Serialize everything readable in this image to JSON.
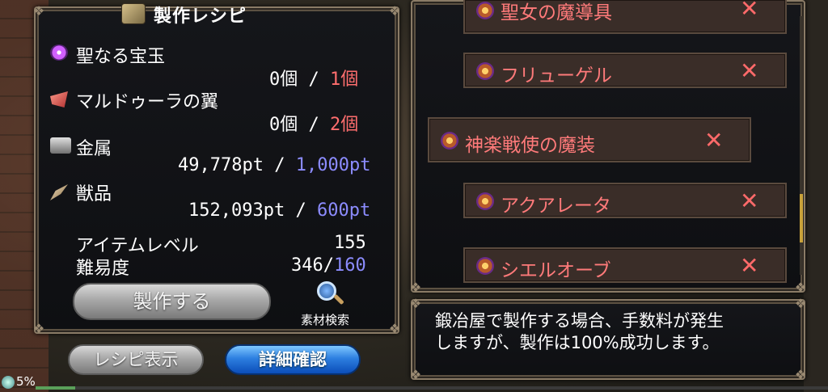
{
  "window": {
    "title": "製作レシピ"
  },
  "materials": [
    {
      "name": "聖なる宝玉",
      "icon": "jewel-icon",
      "have": "0個",
      "need": "1個",
      "need_color": "red"
    },
    {
      "name": "マルドゥーラの翼",
      "icon": "wing-icon",
      "have": "0個",
      "need": "2個",
      "need_color": "red"
    },
    {
      "name": "金属",
      "icon": "metal-ingot-icon",
      "have": "49,778pt",
      "need": "1,000pt",
      "need_color": "blue"
    },
    {
      "name": "獣品",
      "icon": "fang-icon",
      "have": "152,093pt",
      "need": "600pt",
      "need_color": "blue"
    }
  ],
  "separator": "/",
  "stats": {
    "item_level_label": "アイテムレベル",
    "item_level_value": "155",
    "difficulty_label": "難易度",
    "difficulty_current": "346/",
    "difficulty_max": "160"
  },
  "buttons": {
    "craft": "製作する",
    "material_search": "素材検索",
    "recipe_display": "レシピ表示",
    "details": "詳細確認"
  },
  "recipes": [
    {
      "label": "聖女の魔導具",
      "remove": "✕"
    },
    {
      "label": "フリューゲル",
      "remove": "✕"
    },
    {
      "label": "神楽戦使の魔装",
      "remove": "✕",
      "selected": true
    },
    {
      "label": "アクアレータ",
      "remove": "✕"
    },
    {
      "label": "シエルオーブ",
      "remove": "✕"
    }
  ],
  "message": "鍛冶屋で製作する場合、手数料が発生\nしますが、製作は100%成功します。",
  "progress": {
    "percent_label": "5%",
    "fraction": 0.05
  },
  "colors": {
    "need_red": "#ff6e6e",
    "need_blue": "#8c8cff",
    "recipe_text": "#ff7a7a"
  }
}
